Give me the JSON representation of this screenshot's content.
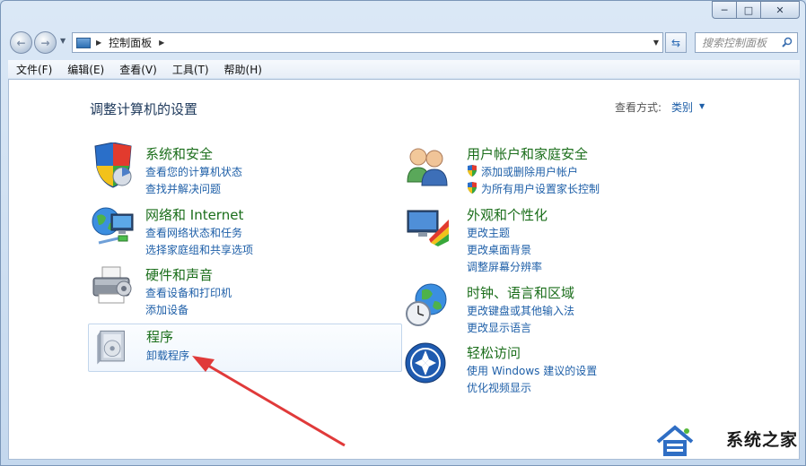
{
  "window": {
    "minimize_glyph": "─",
    "maximize_glyph": "□",
    "close_glyph": "✕"
  },
  "nav": {
    "back_glyph": "←",
    "forward_glyph": "→",
    "address_crumb": "控制面板",
    "search_placeholder": "搜索控制面板"
  },
  "menu": {
    "items": [
      "文件(F)",
      "编辑(E)",
      "查看(V)",
      "工具(T)",
      "帮助(H)"
    ]
  },
  "page": {
    "title": "调整计算机的设置",
    "view_by_label": "查看方式:",
    "view_by_value": "类别"
  },
  "categories": {
    "system": {
      "title": "系统和安全",
      "links": [
        "查看您的计算机状态",
        "查找并解决问题"
      ]
    },
    "network": {
      "title": "网络和 Internet",
      "links": [
        "查看网络状态和任务",
        "选择家庭组和共享选项"
      ]
    },
    "hardware": {
      "title": "硬件和声音",
      "links": [
        "查看设备和打印机",
        "添加设备"
      ]
    },
    "programs": {
      "title": "程序",
      "links": [
        "卸载程序"
      ]
    },
    "accounts": {
      "title": "用户帐户和家庭安全",
      "links": [
        "添加或删除用户帐户",
        "为所有用户设置家长控制"
      ]
    },
    "appearance": {
      "title": "外观和个性化",
      "links": [
        "更改主题",
        "更改桌面背景",
        "调整屏幕分辨率"
      ]
    },
    "clock": {
      "title": "时钟、语言和区域",
      "links": [
        "更改键盘或其他输入法",
        "更改显示语言"
      ]
    },
    "ease": {
      "title": "轻松访问",
      "links": [
        "使用 Windows 建议的设置",
        "优化视频显示"
      ]
    }
  },
  "watermark": {
    "text": "系统之家"
  },
  "colors": {
    "link": "#1e5fa8",
    "category_title": "#1b6e1b",
    "annotation_arrow": "#e03a3a"
  }
}
